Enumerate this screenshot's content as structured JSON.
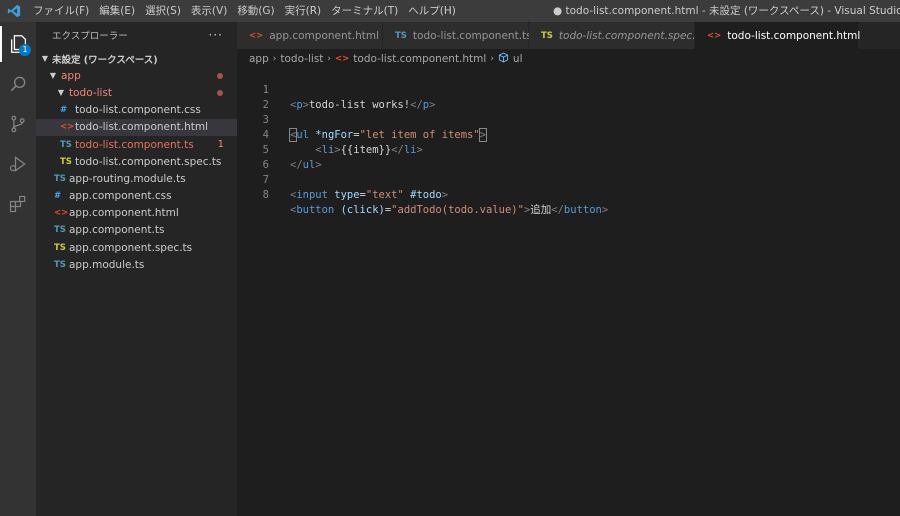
{
  "menu": [
    "ファイル(F)",
    "編集(E)",
    "選択(S)",
    "表示(V)",
    "移動(G)",
    "実行(R)",
    "ターミナル(T)",
    "ヘルプ(H)"
  ],
  "window_title": "● todo-list.component.html - 未設定 (ワークスペース) - Visual Studio Code",
  "activity": {
    "explorer_badge": "1"
  },
  "sidebar": {
    "title": "エクスプローラー",
    "more": "···",
    "workspace": "未設定 (ワークスペース)",
    "tree": [
      {
        "label": "app"
      },
      {
        "label": "todo-list"
      },
      {
        "label": "todo-list.component.css",
        "icon": "#"
      },
      {
        "label": "todo-list.component.html",
        "icon": "<>"
      },
      {
        "label": "todo-list.component.ts",
        "icon": "TS",
        "problems": "1"
      },
      {
        "label": "todo-list.component.spec.ts",
        "icon": "TS"
      },
      {
        "label": "app-routing.module.ts",
        "icon": "TS"
      },
      {
        "label": "app.component.css",
        "icon": "#"
      },
      {
        "label": "app.component.html",
        "icon": "<>"
      },
      {
        "label": "app.component.ts",
        "icon": "TS"
      },
      {
        "label": "app.component.spec.ts",
        "icon": "TS"
      },
      {
        "label": "app.module.ts",
        "icon": "TS"
      }
    ]
  },
  "tabs": [
    {
      "label": "app.component.html",
      "icon": "<>"
    },
    {
      "label": "todo-list.component.ts",
      "icon": "TS"
    },
    {
      "label": "todo-list.component.spec.ts",
      "icon": "TS"
    },
    {
      "label": "todo-list.component.html",
      "icon": "<>"
    }
  ],
  "breadcrumb": {
    "parts": [
      "app",
      "todo-list",
      "todo-list.component.html",
      "ul"
    ]
  },
  "code": {
    "line_numbers": [
      "1",
      "2",
      "3",
      "4",
      "5",
      "6",
      "7",
      "8"
    ],
    "l1": {
      "open": "<",
      "tag": "p",
      "close": ">",
      "text": "todo-list works!",
      "etag": "</",
      "tag2": "p",
      "eclose": ">"
    },
    "l3": {
      "open": "<",
      "tag": "ul",
      "attr": " *ngFor",
      "eq": "=",
      "val": "\"let item of items\"",
      "close": ">"
    },
    "l4": {
      "indent": "    ",
      "open": "<",
      "tag": "li",
      "close": ">",
      "text": "{{item}}",
      "etag": "</",
      "tag2": "li",
      "eclose": ">"
    },
    "l5": {
      "etag": "</",
      "tag": "ul",
      "eclose": ">"
    },
    "l7": {
      "open": "<",
      "tag": "input",
      "attr1": " type",
      "eq1": "=",
      "val1": "\"text\"",
      "attr2": " #todo",
      "close": ">"
    },
    "l8": {
      "open": "<",
      "tag": "button",
      "attr": " (click)",
      "eq": "=",
      "val": "\"addTodo(todo.value)\"",
      "close": ">",
      "text": "追加",
      "etag": "</",
      "tag2": "button",
      "eclose": ">"
    }
  }
}
